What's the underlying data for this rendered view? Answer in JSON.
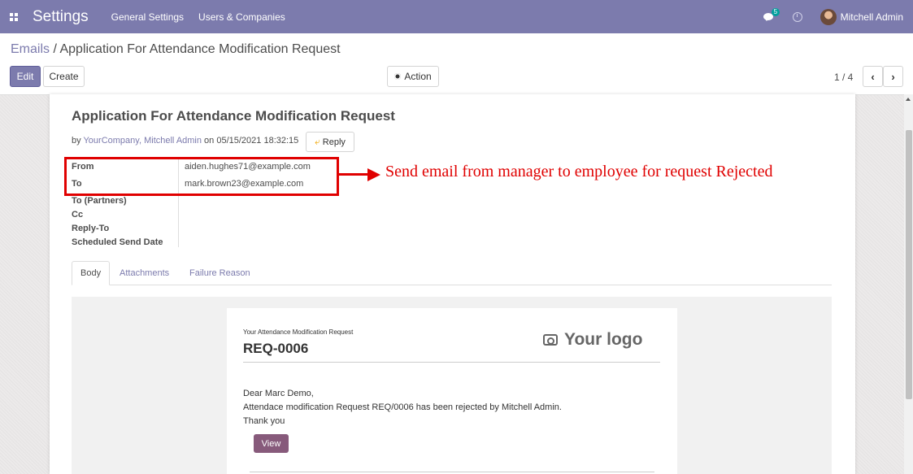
{
  "navbar": {
    "app_title": "Settings",
    "menus": [
      "General Settings",
      "Users & Companies"
    ],
    "message_count": "5",
    "user_name": "Mitchell Admin"
  },
  "breadcrumb": {
    "parent": "Emails",
    "separator": " / ",
    "current": "Application For Attendance Modification Request"
  },
  "toolbar": {
    "edit_label": "Edit",
    "create_label": "Create",
    "action_label": "Action",
    "pager": "1 / 4"
  },
  "message": {
    "subject": "Application For Attendance Modification Request",
    "by_prefix": "by ",
    "authors": "YourCompany, Mitchell Admin",
    "on_text": " on 05/15/2021 18:32:15",
    "reply_label": "Reply",
    "field_labels": [
      "From",
      "To",
      "To (Partners)",
      "Cc",
      "Reply-To",
      "Scheduled Send Date"
    ],
    "from": "aiden.hughes71@example.com",
    "to": "mark.brown23@example.com"
  },
  "annotation": {
    "text": "Send email from manager to employee for request Rejected",
    "color": "#e00000"
  },
  "tabs": [
    "Body",
    "Attachments",
    "Failure Reason"
  ],
  "email_body": {
    "subtitle": "Your Attendance Modification Request",
    "reference": "REQ-0006",
    "logo_text": "Your logo",
    "greeting": "Dear Marc Demo,",
    "line1": "Attendace modification Request REQ/0006 has been rejected by Mitchell Admin.",
    "line2": "Thank you",
    "button_label": "View"
  },
  "colors": {
    "navbar": "#7c7bad",
    "accent": "#7c7bad",
    "view_button": "#875a7b"
  }
}
